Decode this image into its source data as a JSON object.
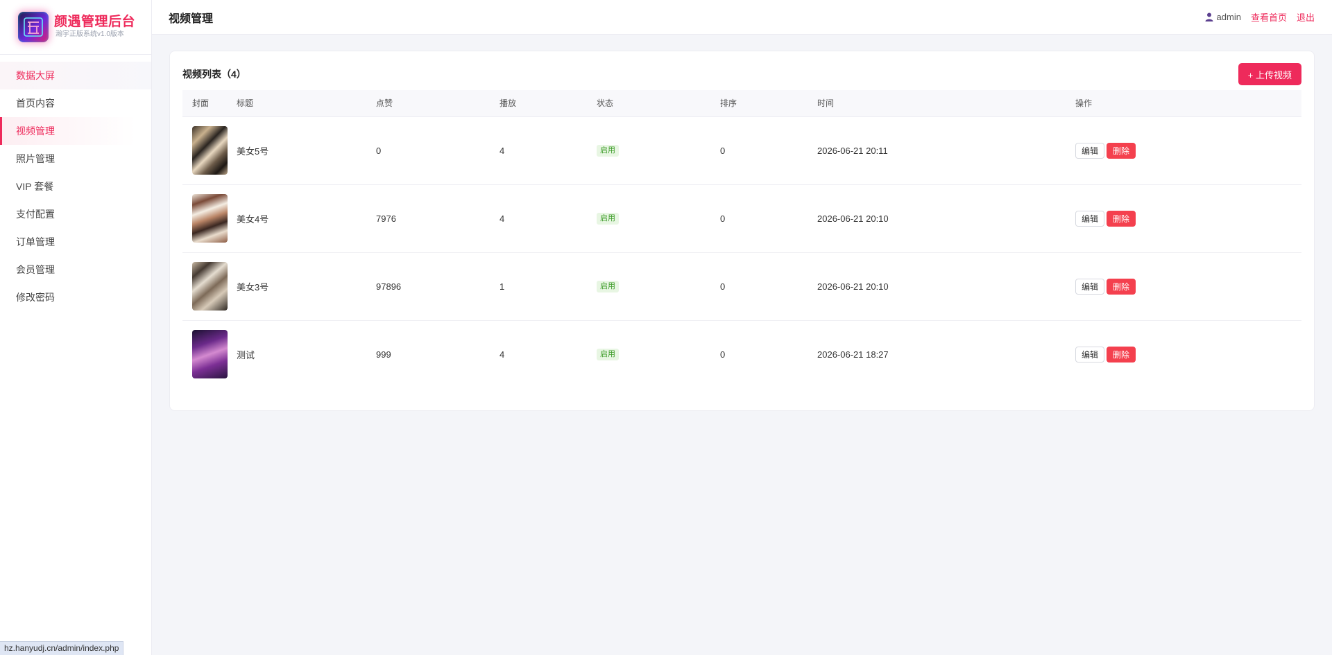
{
  "brand": {
    "title": "颜遇管理后台",
    "subtitle": "瀚宇正版系统v1.0版本"
  },
  "sidebar": {
    "items": [
      {
        "label": "数据大屏"
      },
      {
        "label": "首页内容"
      },
      {
        "label": "视频管理"
      },
      {
        "label": "照片管理"
      },
      {
        "label": "VIP 套餐"
      },
      {
        "label": "支付配置"
      },
      {
        "label": "订单管理"
      },
      {
        "label": "会员管理"
      },
      {
        "label": "修改密码"
      }
    ]
  },
  "topbar": {
    "title": "视频管理",
    "username": "admin",
    "home_link": "查看首页",
    "logout_link": "退出"
  },
  "card": {
    "title": "视频列表（4）",
    "upload_label": "+ 上传视频"
  },
  "table": {
    "headers": {
      "cover": "封面",
      "title": "标题",
      "likes": "点赞",
      "plays": "播放",
      "status": "状态",
      "sort": "排序",
      "time": "时间",
      "actions": "操作"
    },
    "rows": [
      {
        "title": "美女5号",
        "likes": "0",
        "plays": "4",
        "status": "启用",
        "sort": "0",
        "time": "2026-06-21 20:11"
      },
      {
        "title": "美女4号",
        "likes": "7976",
        "plays": "4",
        "status": "启用",
        "sort": "0",
        "time": "2026-06-21 20:10"
      },
      {
        "title": "美女3号",
        "likes": "97896",
        "plays": "1",
        "status": "启用",
        "sort": "0",
        "time": "2026-06-21 20:10"
      },
      {
        "title": "测试",
        "likes": "999",
        "plays": "4",
        "status": "启用",
        "sort": "0",
        "time": "2026-06-21 18:27"
      }
    ],
    "edit_label": "编辑",
    "delete_label": "删除"
  },
  "statusbar": {
    "url": "hz.hanyudj.cn/admin/index.php"
  },
  "colors": {
    "accent": "#ee2a5b",
    "danger": "#f4404e",
    "success": "#3f9d2b",
    "background": "#f4f5f9"
  }
}
